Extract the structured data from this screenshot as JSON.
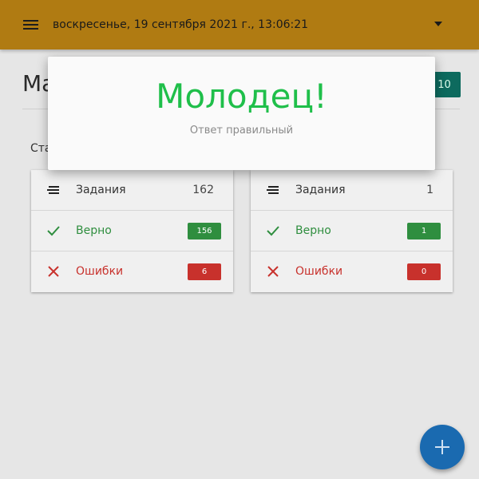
{
  "appbar": {
    "title": "воскресенье, 19 сентября 2021 г., 13:06:21",
    "menu_icon": "hamburger-menu-icon",
    "dropdown_icon": "caret-down-icon",
    "color": "#b07b12"
  },
  "page": {
    "heading": "Ма",
    "section_label": "Ста",
    "top_right_badge": "10"
  },
  "cards": [
    {
      "rows": [
        {
          "icon": "lines-icon",
          "label": "Задания",
          "value": "162"
        },
        {
          "icon": "check-icon",
          "label": "Верно",
          "value": "156"
        },
        {
          "icon": "cross-icon",
          "label": "Ошибки",
          "value": "6"
        }
      ]
    },
    {
      "rows": [
        {
          "icon": "lines-icon",
          "label": "Задания",
          "value": "1"
        },
        {
          "icon": "check-icon",
          "label": "Верно",
          "value": "1"
        },
        {
          "icon": "cross-icon",
          "label": "Ошибки",
          "value": "0"
        }
      ]
    }
  ],
  "fab": {
    "icon": "plus-icon",
    "color": "#1a6ab0"
  },
  "modal": {
    "title": "Молодец!",
    "subtitle": "Ответ правильный",
    "title_color": "#1fbf4a"
  },
  "colors": {
    "correct": "#2f8e3f",
    "error": "#c8312c"
  }
}
